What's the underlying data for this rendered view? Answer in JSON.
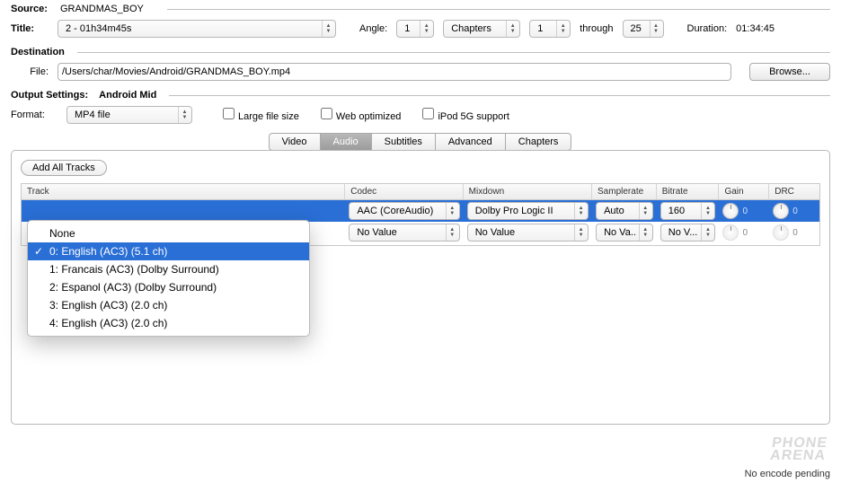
{
  "source": {
    "label": "Source:",
    "name": "GRANDMAS_BOY"
  },
  "title": {
    "label": "Title:",
    "value": "2 - 01h34m45s"
  },
  "angle": {
    "label": "Angle:",
    "value": "1"
  },
  "chapters": {
    "mode": "Chapters",
    "from": "1",
    "through_label": "through",
    "to": "25"
  },
  "duration": {
    "label": "Duration:",
    "value": "01:34:45"
  },
  "destination": {
    "label": "Destination"
  },
  "file": {
    "label": "File:",
    "value": "/Users/char/Movies/Android/GRANDMAS_BOY.mp4",
    "browse": "Browse..."
  },
  "output": {
    "label": "Output Settings:",
    "preset": "Android Mid"
  },
  "format": {
    "label": "Format:",
    "value": "MP4 file",
    "large_file": "Large file size",
    "web_opt": "Web optimized",
    "ipod": "iPod 5G support"
  },
  "tabs": {
    "video": "Video",
    "audio": "Audio",
    "subtitles": "Subtitles",
    "advanced": "Advanced",
    "chapters": "Chapters"
  },
  "audio_panel": {
    "add_all": "Add All Tracks",
    "headers": {
      "track": "Track",
      "codec": "Codec",
      "mixdown": "Mixdown",
      "samplerate": "Samplerate",
      "bitrate": "Bitrate",
      "gain": "Gain",
      "drc": "DRC"
    },
    "rows": [
      {
        "codec": "AAC (CoreAudio)",
        "mixdown": "Dolby Pro Logic II",
        "samplerate": "Auto",
        "bitrate": "160",
        "gain": "0",
        "drc": "0"
      },
      {
        "codec": "No Value",
        "mixdown": "No Value",
        "samplerate": "No Va...",
        "bitrate": "No V...",
        "gain": "0",
        "drc": "0"
      }
    ]
  },
  "track_menu": {
    "none": "None",
    "items": [
      "0: English (AC3) (5.1 ch)",
      "1: Francais (AC3) (Dolby Surround)",
      "2: Espanol (AC3) (Dolby Surround)",
      "3: English (AC3) (2.0 ch)",
      "4: English (AC3) (2.0 ch)"
    ]
  },
  "status": "No encode pending",
  "watermark_l1": "PHONE",
  "watermark_l2": "ARENA"
}
